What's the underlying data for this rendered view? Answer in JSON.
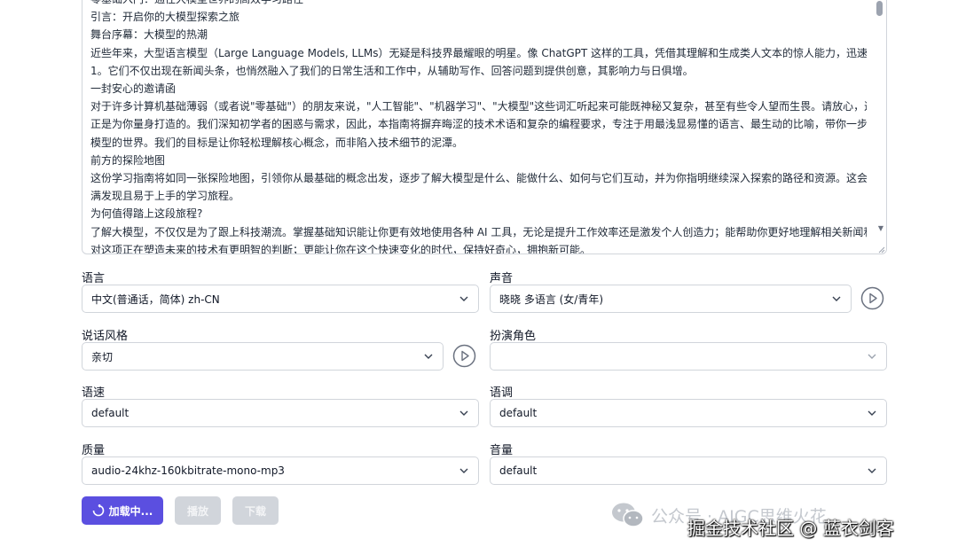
{
  "document_text": [
    "零基础入门：通往大模型世界的高效学习路径",
    "引言：开启你的大模型探索之旅",
    "舞台序幕：大模型的热潮",
    "近些年来，大型语言模型（Large Language Models, LLMs）无疑是科技界最耀眼的明星。像 ChatGPT 这样的工具，凭借其理解和生成类人文本的惊人能力，迅速走红全球",
    "1。它们不仅出现在新闻头条，也悄然融入了我们的日常生活和工作中，从辅助写作、回答问题到提供创意，其影响力与日俱增。",
    "一封安心的邀请函",
    "对于许多计算机基础薄弱（或者说\"零基础\"）的朋友来说，\"人工智能\"、\"机器学习\"、\"大模型\"这些词汇听起来可能既神秘又复杂，甚至有些令人望而生畏。请放心，这份指南",
    "正是为你量身打造的。我们深知初学者的困惑与需求，因此，本指南将摒弃晦涩的技术术语和复杂的编程要求，专注于用最浅显易懂的语言、最生动的比喻，带你一步步走进大",
    "模型的世界。我们的目标是让你轻松理解核心概念，而非陷入技术细节的泥潭。",
    "前方的探险地图",
    "这份学习指南将如同一张探险地图，引领你从最基础的概念出发，逐步了解大模型是什么、能做什么、如何与它们互动，并为你指明继续深入探索的路径和资源。这会是一段充",
    "满发现且易于上手的学习旅程。",
    "为何值得踏上这段旅程?",
    "了解大模型，不仅仅是为了跟上科技潮流。掌握基础知识能让你更有效地使用各种 AI 工具，无论是提升工作效率还是激发个人创造力；能帮助你更好地理解相关新闻和讨论，",
    "对这项正在塑造未来的技术有更明智的判断；更能让你在这个快速变化的时代，保持好奇心，拥抱新可能。"
  ],
  "fields": {
    "language": {
      "label": "语言",
      "value": "中文(普通话，简体) zh-CN"
    },
    "voice": {
      "label": "声音",
      "value": "晓晓 多语言 (女/青年)"
    },
    "style": {
      "label": "说话风格",
      "value": "亲切"
    },
    "role": {
      "label": "扮演角色",
      "value": ""
    },
    "rate": {
      "label": "语速",
      "value": "default"
    },
    "pitch": {
      "label": "语调",
      "value": "default"
    },
    "quality": {
      "label": "质量",
      "value": "audio-24khz-160kbitrate-mono-mp3"
    },
    "volume": {
      "label": "音量",
      "value": "default"
    }
  },
  "buttons": {
    "load": "加载中...",
    "play": "播放",
    "download": "下载"
  },
  "watermarks": {
    "wechat": "公众号 · AIGC思维火花",
    "juejin": "掘金技术社区 @ 蓝衣剑客"
  },
  "colors": {
    "primary": "#5b4fe0",
    "disabled": "#d1d5db",
    "border": "#d1d5db"
  },
  "icons": [
    "chevron-down-icon",
    "play-circle-icon",
    "spinner-icon",
    "wechat-icon"
  ]
}
